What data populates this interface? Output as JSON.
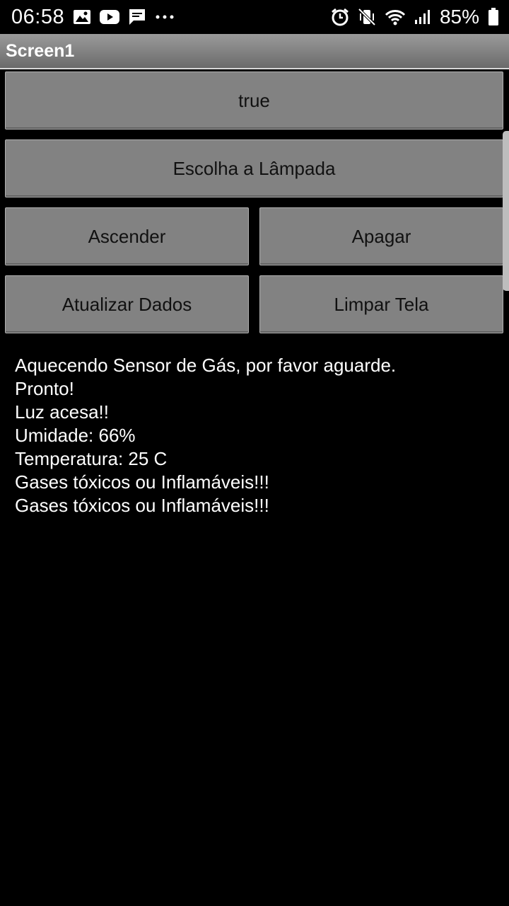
{
  "status_bar": {
    "time": "06:58",
    "battery": "85%",
    "left_icons": [
      "image-icon",
      "youtube-icon",
      "message-icon",
      "more-icon"
    ],
    "right_icons": [
      "alarm-icon",
      "vibrate-mute-icon",
      "wifi-icon",
      "signal-icon",
      "battery-icon"
    ]
  },
  "app_bar": {
    "title": "Screen1"
  },
  "buttons": {
    "true_label": "true",
    "lamp_label": "Escolha a Lâmpada",
    "on_label": "Ascender",
    "off_label": "Apagar",
    "refresh_label": "Atualizar Dados",
    "clear_label": "Limpar Tela"
  },
  "log": [
    "Aquecendo Sensor de Gás, por favor aguarde.",
    "Pronto!",
    "Luz acesa!!",
    "Umidade: 66%",
    "Temperatura: 25 C",
    "Gases tóxicos ou Inflamáveis!!!",
    "Gases tóxicos ou Inflamáveis!!!"
  ],
  "colors": {
    "background": "#000000",
    "button": "#828282",
    "app_bar": "#7f7f7f",
    "text": "#ffffff"
  }
}
